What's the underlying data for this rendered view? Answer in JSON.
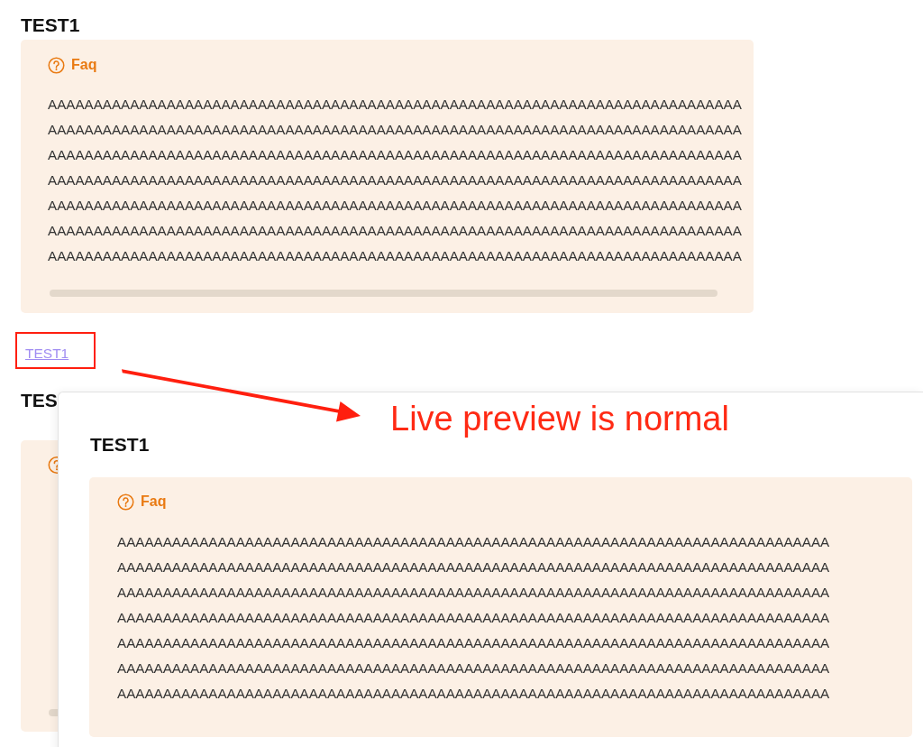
{
  "page": {
    "heading": "TEST1",
    "callout": {
      "title": "Faq",
      "lines": [
        "AAAAAAAAAAAAAAAAAAAAAAAAAAAAAAAAAAAAAAAAAAAAAAAAAAAAAAAAAAAAAAAAAAAAAAAAAAAA",
        "AAAAAAAAAAAAAAAAAAAAAAAAAAAAAAAAAAAAAAAAAAAAAAAAAAAAAAAAAAAAAAAAAAAAAAAAAAAA",
        "AAAAAAAAAAAAAAAAAAAAAAAAAAAAAAAAAAAAAAAAAAAAAAAAAAAAAAAAAAAAAAAAAAAAAAAAAAAA",
        "AAAAAAAAAAAAAAAAAAAAAAAAAAAAAAAAAAAAAAAAAAAAAAAAAAAAAAAAAAAAAAAAAAAAAAAAAAAA",
        "AAAAAAAAAAAAAAAAAAAAAAAAAAAAAAAAAAAAAAAAAAAAAAAAAAAAAAAAAAAAAAAAAAAAAAAAAAAA",
        "AAAAAAAAAAAAAAAAAAAAAAAAAAAAAAAAAAAAAAAAAAAAAAAAAAAAAAAAAAAAAAAAAAAAAAAAAAAA",
        "AAAAAAAAAAAAAAAAAAAAAAAAAAAAAAAAAAAAAAAAAAAAAAAAAAAAAAAAAAAAAAAAAAAAAAAAAAAA"
      ]
    },
    "link": "TEST1",
    "next_heading": "TES"
  },
  "preview": {
    "heading": "TEST1",
    "callout": {
      "title": "Faq",
      "lines": [
        "AAAAAAAAAAAAAAAAAAAAAAAAAAAAAAAAAAAAAAAAAAAAAAAAAAAAAAAAAAAAAAAAAAAAAAAAAAAAAA",
        "AAAAAAAAAAAAAAAAAAAAAAAAAAAAAAAAAAAAAAAAAAAAAAAAAAAAAAAAAAAAAAAAAAAAAAAAAAAAAA",
        "AAAAAAAAAAAAAAAAAAAAAAAAAAAAAAAAAAAAAAAAAAAAAAAAAAAAAAAAAAAAAAAAAAAAAAAAAAAAAA",
        "AAAAAAAAAAAAAAAAAAAAAAAAAAAAAAAAAAAAAAAAAAAAAAAAAAAAAAAAAAAAAAAAAAAAAAAAAAAAAA",
        "AAAAAAAAAAAAAAAAAAAAAAAAAAAAAAAAAAAAAAAAAAAAAAAAAAAAAAAAAAAAAAAAAAAAAAAAAAAAAA",
        "AAAAAAAAAAAAAAAAAAAAAAAAAAAAAAAAAAAAAAAAAAAAAAAAAAAAAAAAAAAAAAAAAAAAAAAAAAAAAA",
        "AAAAAAAAAAAAAAAAAAAAAAAAAAAAAAAAAAAAAAAAAAAAAAAAAAAAAAAAAAAAAAAAAAAAAAAAAAAAAA"
      ]
    }
  },
  "annotation": {
    "text": "Live preview is normal"
  }
}
